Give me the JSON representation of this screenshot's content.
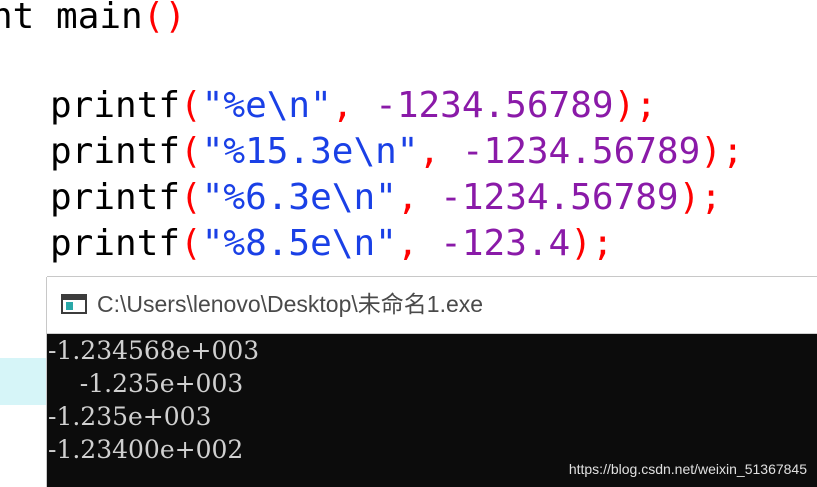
{
  "editor": {
    "lines": [
      {
        "indent": "",
        "tokens": [
          {
            "cls": "tok-kw",
            "text": "nt "
          },
          {
            "cls": "tok-fn",
            "text": "main"
          },
          {
            "cls": "tok-paren",
            "text": "()"
          }
        ]
      },
      {
        "indent": "   ",
        "tokens": [
          {
            "cls": "tok-fn",
            "text": "printf"
          },
          {
            "cls": "tok-paren",
            "text": "("
          },
          {
            "cls": "tok-str",
            "text": "\"%e\\n\""
          },
          {
            "cls": "tok-comma",
            "text": ","
          },
          {
            "cls": "tok-num",
            "text": " -1234.56789"
          },
          {
            "cls": "tok-paren",
            "text": ")"
          },
          {
            "cls": "tok-semi",
            "text": ";"
          }
        ]
      },
      {
        "indent": "   ",
        "tokens": [
          {
            "cls": "tok-fn",
            "text": "printf"
          },
          {
            "cls": "tok-paren",
            "text": "("
          },
          {
            "cls": "tok-str",
            "text": "\"%15.3e\\n\""
          },
          {
            "cls": "tok-comma",
            "text": ","
          },
          {
            "cls": "tok-num",
            "text": " -1234.56789"
          },
          {
            "cls": "tok-paren",
            "text": ")"
          },
          {
            "cls": "tok-semi",
            "text": ";"
          }
        ]
      },
      {
        "indent": "   ",
        "tokens": [
          {
            "cls": "tok-fn",
            "text": "printf"
          },
          {
            "cls": "tok-paren",
            "text": "("
          },
          {
            "cls": "tok-str",
            "text": "\"%6.3e\\n\""
          },
          {
            "cls": "tok-comma",
            "text": ","
          },
          {
            "cls": "tok-num",
            "text": " -1234.56789"
          },
          {
            "cls": "tok-paren",
            "text": ")"
          },
          {
            "cls": "tok-semi",
            "text": ";"
          }
        ]
      },
      {
        "indent": "   ",
        "tokens": [
          {
            "cls": "tok-fn",
            "text": "printf"
          },
          {
            "cls": "tok-paren",
            "text": "("
          },
          {
            "cls": "tok-str",
            "text": "\"%8.5e\\n\""
          },
          {
            "cls": "tok-comma",
            "text": ","
          },
          {
            "cls": "tok-num",
            "text": " -123.4"
          },
          {
            "cls": "tok-paren",
            "text": ")"
          },
          {
            "cls": "tok-semi",
            "text": ";"
          }
        ]
      }
    ]
  },
  "console": {
    "title": "C:\\Users\\lenovo\\Desktop\\未命名1.exe",
    "output": [
      "-1.234568e+003",
      "    -1.235e+003",
      "-1.235e+003",
      "-1.23400e+002"
    ]
  },
  "watermark": "https://blog.csdn.net/weixin_51367845",
  "colors": {
    "paren": "#ff0000",
    "string": "#1a40e6",
    "number": "#8a1aa8",
    "console_bg": "#0c0c0c",
    "console_text": "#d0d0d0",
    "line_highlight": "#d6f5f8"
  },
  "icons": {
    "console": "console-window-icon"
  }
}
